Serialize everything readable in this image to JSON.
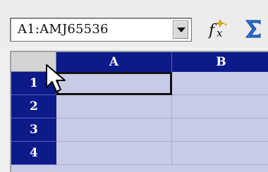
{
  "toolbar": {
    "namebox_value": "A1:AMJ65536",
    "icons": [
      "dropdown-arrow-icon",
      "function-wizard-icon",
      "sum-icon"
    ]
  },
  "sheet": {
    "columns": [
      "A",
      "B"
    ],
    "rows": [
      "1",
      "2",
      "3",
      "4"
    ],
    "active_cell": "A1",
    "colors": {
      "header_bg": "#0c1a8a",
      "selection_bg": "#c7cbe6"
    }
  }
}
